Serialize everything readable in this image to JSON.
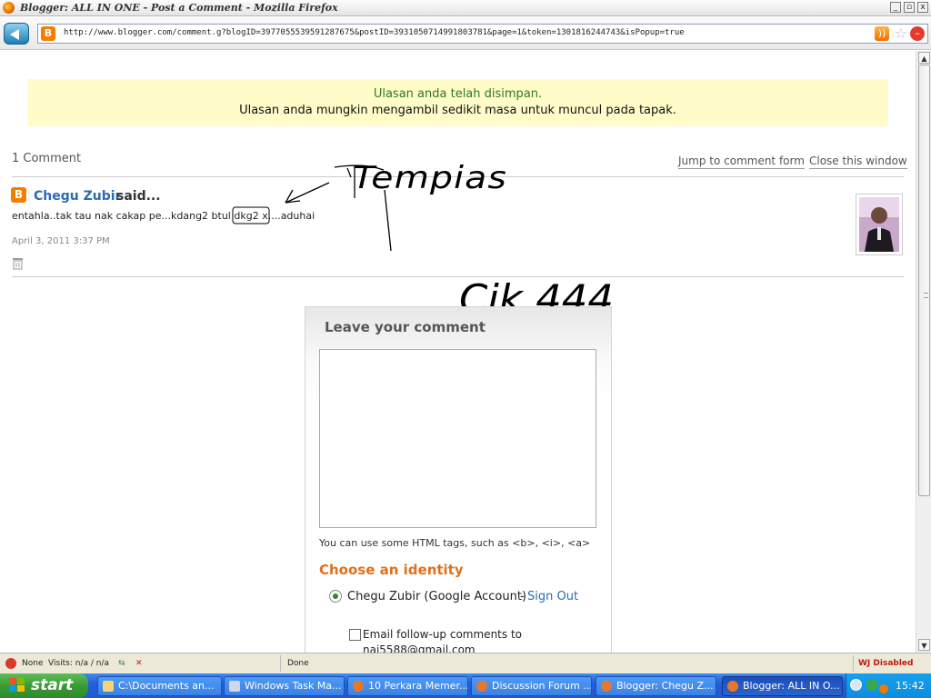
{
  "window": {
    "title": "Blogger: ALL IN ONE - Post a Comment - Mozilla Firefox",
    "minimize": "_",
    "maximize": "▫",
    "close": "x"
  },
  "navbar": {
    "url": "http://www.blogger.com/comment.g?blogID=3977055539591287675&postID=3931050714991803781&page=1&token=1301816244743&isPopup=true"
  },
  "notice": {
    "line1": "Ulasan anda telah disimpan.",
    "line2": "Ulasan anda mungkin mengambil sedikit masa untuk muncul pada tapak."
  },
  "comments_header": {
    "count": "1 Comment",
    "jump_link": "Jump to comment form",
    "close_link": "Close this window"
  },
  "comment": {
    "author": "Chegu Zubir",
    "said": "said...",
    "body": "entahla..tak tau nak cakap pe...kdang2 btul dkg2 x....aduhai",
    "date": "April 3, 2011 3:37 PM"
  },
  "annotation": {
    "word1": "Tempias",
    "word2": "Cik 444"
  },
  "form": {
    "heading": "Leave your comment",
    "hint": "You can use some HTML tags, such as <b>, <i>, <a>",
    "choose_identity": "Choose an identity",
    "identity": "Chegu Zubir (Google Account)",
    "dash": "-",
    "sign_out": "Sign Out",
    "email_line1": "Email follow-up comments to",
    "email_line2": "naj5588@gmail.com"
  },
  "statusbar": {
    "none": "None",
    "visits": "Visits: n/a / n/a",
    "status": "Done",
    "wj": "WJ Disabled"
  },
  "taskbar": {
    "start": "start",
    "tasks": [
      {
        "label": "C:\\Documents an..."
      },
      {
        "label": "Windows Task Ma..."
      },
      {
        "label": "10 Perkara Memer..."
      },
      {
        "label": "Discussion Forum ..."
      },
      {
        "label": "Blogger: Chegu Z..."
      },
      {
        "label": "Blogger: ALL IN O..."
      }
    ],
    "clock": "15:42"
  },
  "colors": {
    "blogger_orange": "#f57d00",
    "notice_bg": "#fffcc9",
    "notice_green": "#2a7a22",
    "link_blue": "#2a6ab5",
    "identity_orange": "#e0701b",
    "taskbar_blue": "#245edb",
    "start_green": "#3a9b35"
  },
  "icons": [
    "firefox-icon",
    "back-arrow-icon",
    "blogger-favicon",
    "rss-icon",
    "bookmark-star-icon",
    "stop-icon",
    "blogger-icon",
    "trash-icon",
    "windows-flag-icon"
  ]
}
